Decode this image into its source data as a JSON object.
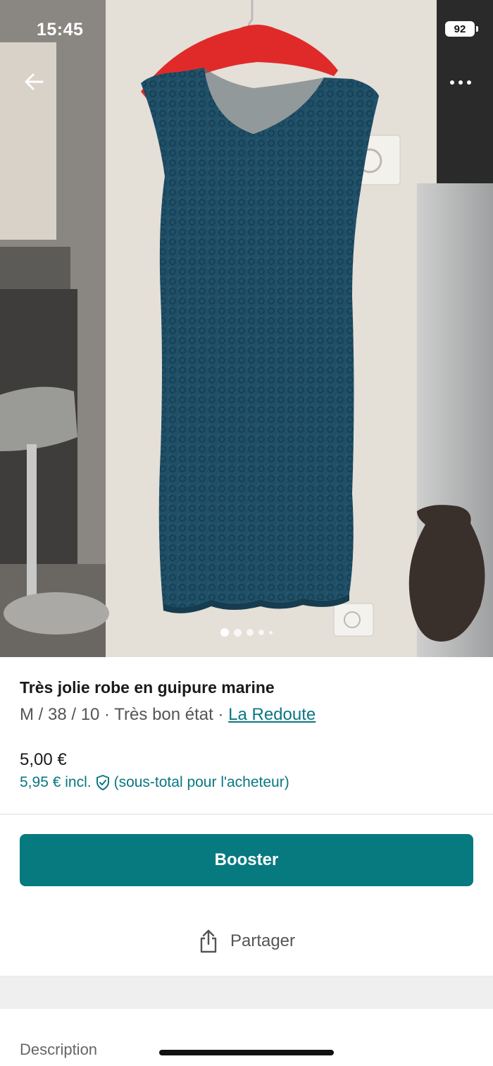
{
  "status_bar": {
    "time": "15:45",
    "battery": "92"
  },
  "photo": {
    "active_index": 0,
    "total": 5
  },
  "product": {
    "title": "Très jolie robe en guipure marine",
    "details": "M / 38 / 10 · Très bon état · ",
    "brand": "La Redoute",
    "price": "5,00 €",
    "price_incl": "5,95 € incl.",
    "price_note": "(sous-total pour l'acheteur)"
  },
  "actions": {
    "booster_label": "Booster",
    "share_label": "Partager"
  },
  "sections": {
    "description_label": "Description"
  },
  "icons": {
    "back": "arrow-left-icon",
    "more": "more-horizontal-icon",
    "shield": "shield-check-icon",
    "share": "share-icon",
    "wifi": "wifi-icon",
    "signal": "signal-icon"
  },
  "colors": {
    "accent": "#077a80",
    "link": "#0a7782",
    "dress": "#1d4a5f"
  }
}
